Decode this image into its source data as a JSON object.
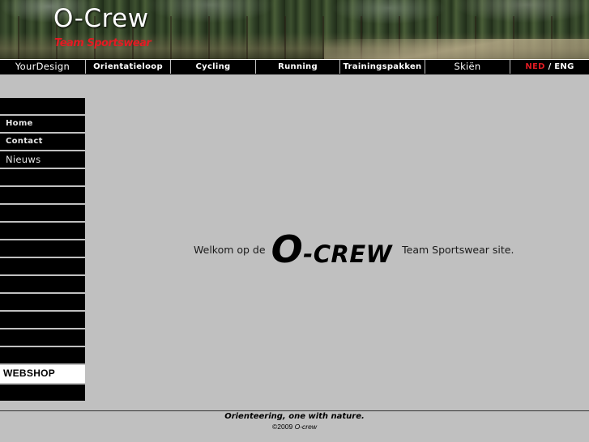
{
  "header": {
    "logo_title": "O-Crew",
    "logo_subtitle": "Team Sportswear"
  },
  "topnav": {
    "items": [
      {
        "label": "YourDesign"
      },
      {
        "label": "Orientatieloop"
      },
      {
        "label": "Cycling"
      },
      {
        "label": "Running"
      },
      {
        "label": "Trainingspakken"
      },
      {
        "label": "Skiën"
      }
    ],
    "lang_active": "NED",
    "lang_separator": " / ",
    "lang_other": "ENG"
  },
  "sidebar": {
    "items": [
      {
        "label": ""
      },
      {
        "label": "Home"
      },
      {
        "label": "Contact"
      },
      {
        "label": "Nieuws"
      },
      {
        "label": ""
      },
      {
        "label": ""
      },
      {
        "label": ""
      },
      {
        "label": ""
      },
      {
        "label": ""
      },
      {
        "label": ""
      },
      {
        "label": ""
      },
      {
        "label": ""
      },
      {
        "label": ""
      },
      {
        "label": ""
      },
      {
        "label": ""
      },
      {
        "label": "WEBSHOP"
      },
      {
        "label": ""
      }
    ]
  },
  "main": {
    "welcome_prefix": "Welkom op de",
    "brand_o": "O",
    "brand_rest": "-CREW",
    "welcome_suffix": "Team Sportswear site."
  },
  "footer": {
    "slogan": "Orienteering, one with nature.",
    "copyright_prefix": "©2009 ",
    "copyright_name": "O-crew"
  },
  "colors": {
    "page_bg": "#c0c0c0",
    "nav_bg": "#000000",
    "accent_red": "#e31b23"
  }
}
